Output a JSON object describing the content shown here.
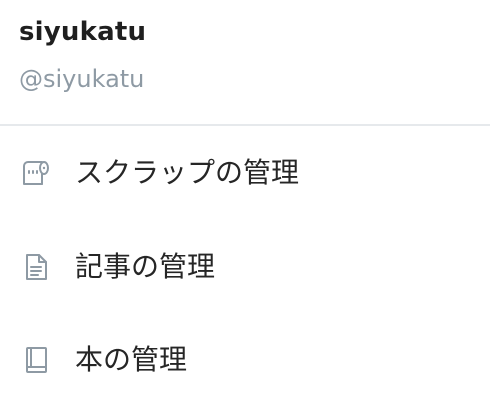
{
  "user": {
    "display_name": "siyukatu",
    "handle": "@siyukatu"
  },
  "menu": {
    "items": [
      {
        "label": "スクラップの管理",
        "icon": "scrap-roll-icon"
      },
      {
        "label": "記事の管理",
        "icon": "document-icon"
      },
      {
        "label": "本の管理",
        "icon": "book-icon"
      }
    ]
  },
  "colors": {
    "text_primary": "#262626",
    "text_secondary": "#8e9aa4",
    "icon": "#8e9aa4",
    "divider": "#e6e9ec",
    "background": "#ffffff"
  }
}
